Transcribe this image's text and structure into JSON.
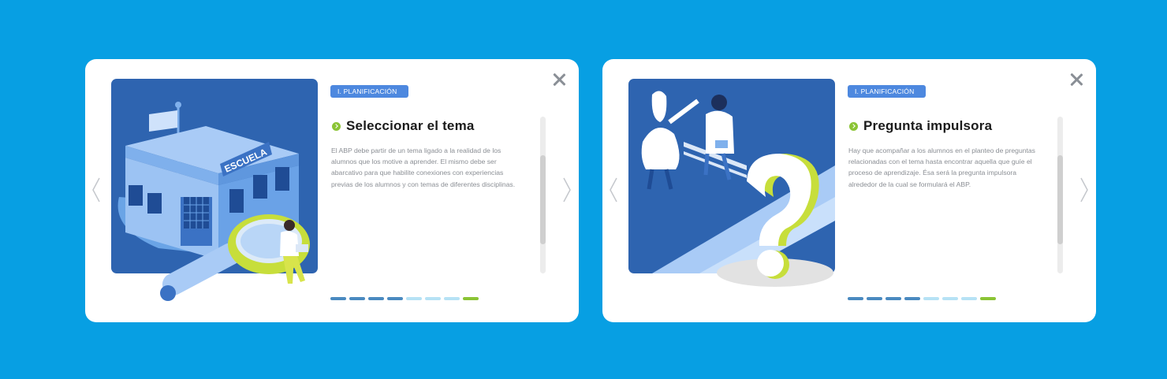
{
  "cards": [
    {
      "badge": "I. PLANIFICACIÓN",
      "title": "Seleccionar el tema",
      "body": "El ABP debe partir de un tema ligado a la realidad de los alumnos que los motive a aprender. El mismo debe ser abarcativo para que habilite conexiones con experiencias previas de los alumnos y con temas de diferentes disciplinas.",
      "sign_text": "ESCUELA",
      "steps": [
        "done",
        "done",
        "done",
        "done",
        "pending",
        "pending",
        "pending",
        "current"
      ],
      "scroll_position_fraction": 0.43
    },
    {
      "badge": "I. PLANIFICACIÓN",
      "title": "Pregunta impulsora",
      "body": "Hay que acompañar a los alumnos en el planteo de preguntas relacionadas con el tema hasta encontrar aquella que guíe el proceso de aprendizaje. Ésa será la pregunta impulsora alrededor de la cual se formulará el ABP.",
      "steps": [
        "done",
        "done",
        "done",
        "done",
        "pending",
        "pending",
        "pending",
        "current"
      ],
      "scroll_position_fraction": 0.43
    }
  ],
  "icons": {
    "close": "close-icon",
    "prev": "chevron-left-icon",
    "next": "chevron-right-icon",
    "bullet": "chevron-circle-icon"
  },
  "colors": {
    "background": "#079fe3",
    "badge": "#4d88df",
    "bullet": "#8bc435",
    "step_done": "#4a8ac0",
    "step_pending": "#b6e2f5",
    "step_current": "#8bc435"
  }
}
